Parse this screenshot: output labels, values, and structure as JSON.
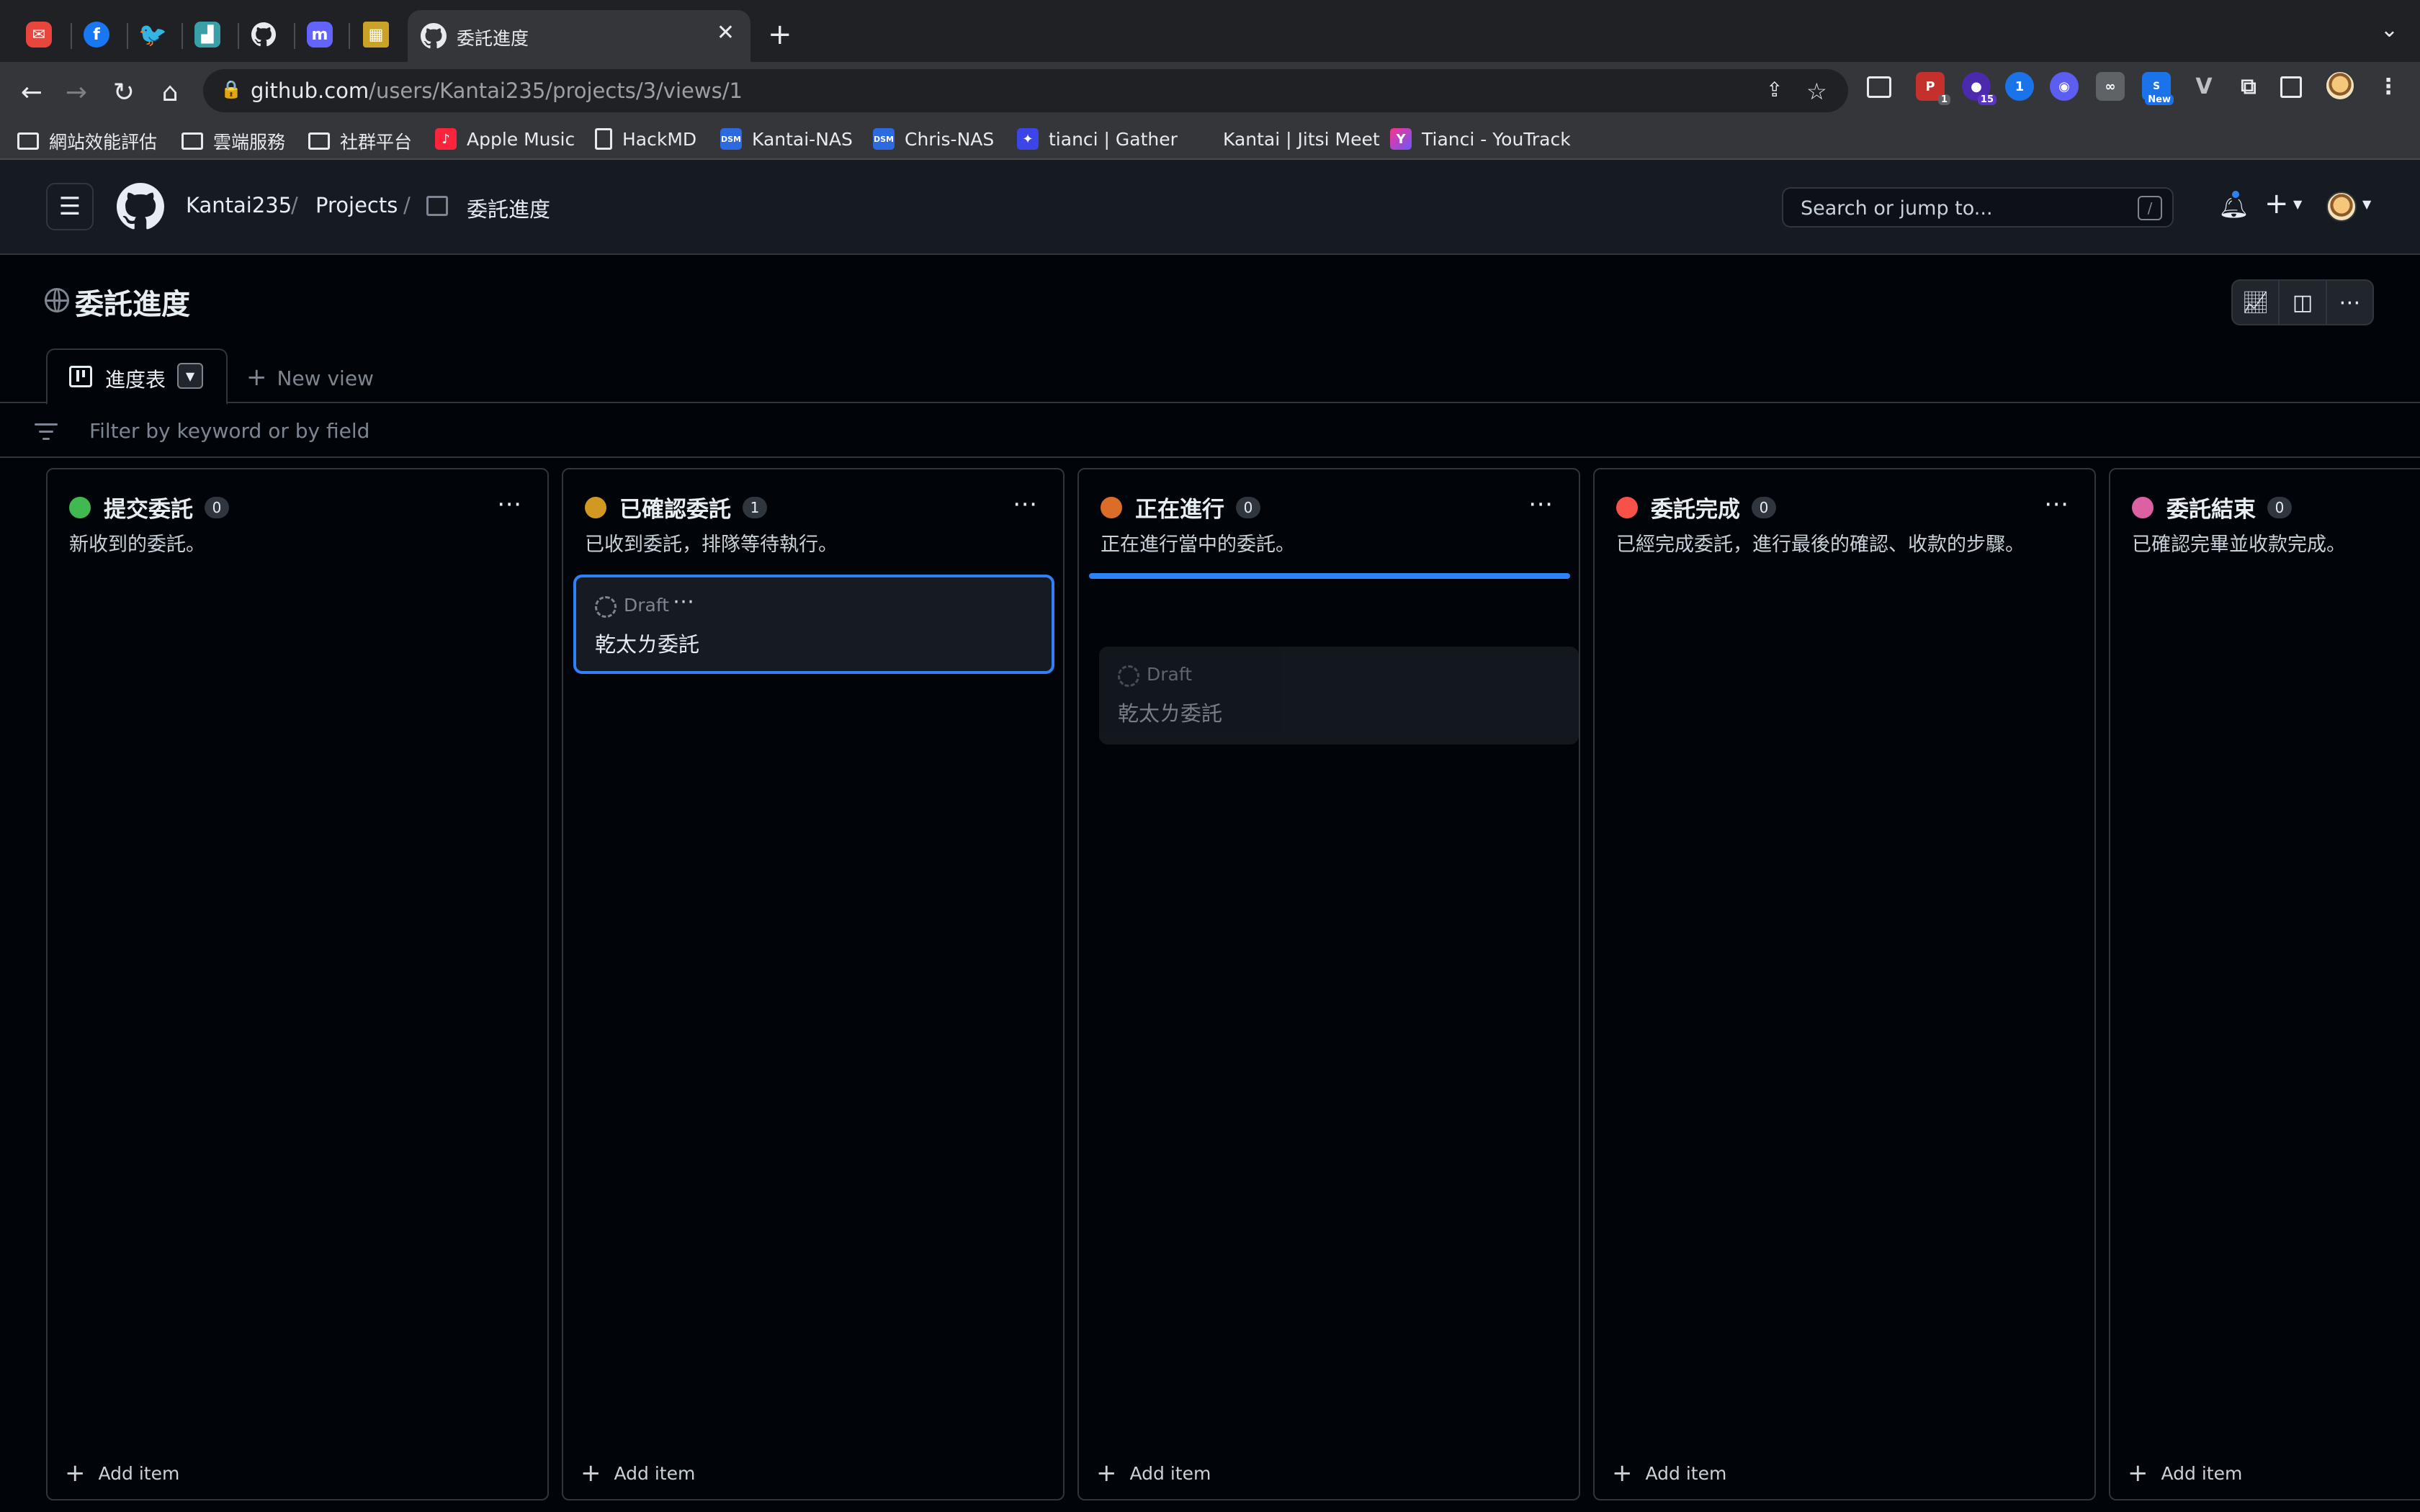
{
  "browser": {
    "active_tab_title": "委託進度",
    "url_domain": "github.com",
    "url_path": "/users/Kantai235/projects/3/views/1",
    "bookmarks": [
      {
        "label": "網站效能評估",
        "icon": "folder-icon"
      },
      {
        "label": "雲端服務",
        "icon": "folder-icon"
      },
      {
        "label": "社群平台",
        "icon": "folder-icon"
      },
      {
        "label": "Apple Music",
        "icon": "music-icon"
      },
      {
        "label": "HackMD",
        "icon": "document-icon"
      },
      {
        "label": "Kantai-NAS",
        "icon": "dsm-icon"
      },
      {
        "label": "Chris-NAS",
        "icon": "dsm-icon"
      },
      {
        "label": "tianci | Gather",
        "icon": "gather-icon"
      },
      {
        "label": "Kantai | Jitsi Meet",
        "icon": "jitsi-icon"
      },
      {
        "label": "Tianci - YouTrack",
        "icon": "youtrack-icon"
      }
    ],
    "extension_badges": {
      "ext1": "1",
      "ext2": "15",
      "ext3": "New"
    }
  },
  "header": {
    "breadcrumb": {
      "owner": "Kantai235",
      "projects": "Projects",
      "project": "委託進度"
    },
    "search_placeholder": "Search or jump to...",
    "search_shortcut": "/"
  },
  "project": {
    "title": "委託進度",
    "view_tab": "進度表",
    "new_view": "New view",
    "filter_placeholder": "Filter by keyword or by field"
  },
  "columns": [
    {
      "title": "提交委託",
      "count": "0",
      "description": "新收到的委託。",
      "color": "#3fb950",
      "add_label": "Add item"
    },
    {
      "title": "已確認委託",
      "count": "1",
      "description": "已收到委託，排隊等待執行。",
      "color": "#d29922",
      "add_label": "Add item"
    },
    {
      "title": "正在進行",
      "count": "0",
      "description": "正在進行當中的委託。",
      "color": "#db6d28",
      "add_label": "Add item"
    },
    {
      "title": "委託完成",
      "count": "0",
      "description": "已經完成委託，進行最後的確認、收款的步驟。",
      "color": "#f85149",
      "add_label": "Add item"
    },
    {
      "title": "委託結束",
      "count": "0",
      "description": "已確認完畢並收款完成。",
      "color": "#db61a2",
      "add_label": "Add item"
    }
  ],
  "card": {
    "status": "Draft",
    "title": "乾太ㄌ委託"
  },
  "ghost_card": {
    "status": "Draft",
    "title": "乾太ㄌ委託"
  }
}
